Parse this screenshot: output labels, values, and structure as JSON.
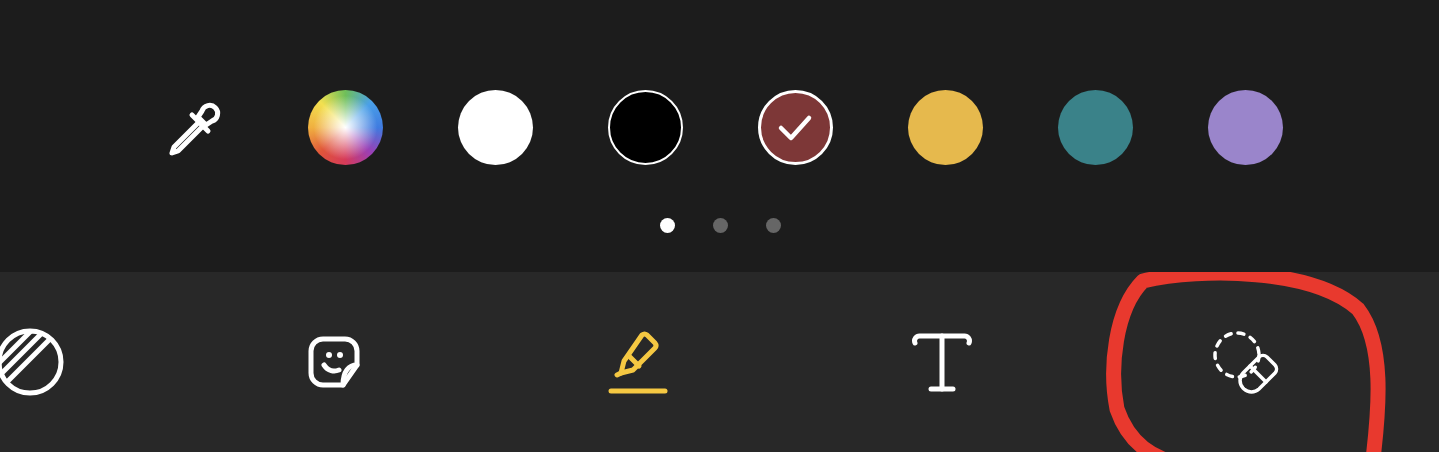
{
  "palette": {
    "eyedropper": {
      "kind": "eyedropper"
    },
    "swatches": [
      {
        "kind": "spectrum",
        "selected": false
      },
      {
        "kind": "solid",
        "color": "#ffffff",
        "selected": false
      },
      {
        "kind": "solid",
        "color": "#000000",
        "selected": false
      },
      {
        "kind": "solid",
        "color": "#7d3737",
        "selected": true
      },
      {
        "kind": "solid",
        "color": "#e6b94d",
        "selected": false
      },
      {
        "kind": "solid",
        "color": "#3a8289",
        "selected": false
      },
      {
        "kind": "solid",
        "color": "#9a85cb",
        "selected": false
      }
    ],
    "pages": [
      {
        "selected": true
      },
      {
        "selected": false
      },
      {
        "selected": false
      }
    ]
  },
  "toolbar": {
    "tools": [
      {
        "kind": "filter",
        "selected": false,
        "circled": false
      },
      {
        "kind": "sticker",
        "selected": false,
        "circled": false
      },
      {
        "kind": "pen",
        "selected": true,
        "circled": false
      },
      {
        "kind": "text",
        "selected": false,
        "circled": false
      },
      {
        "kind": "eraser",
        "selected": false,
        "circled": true
      }
    ]
  }
}
